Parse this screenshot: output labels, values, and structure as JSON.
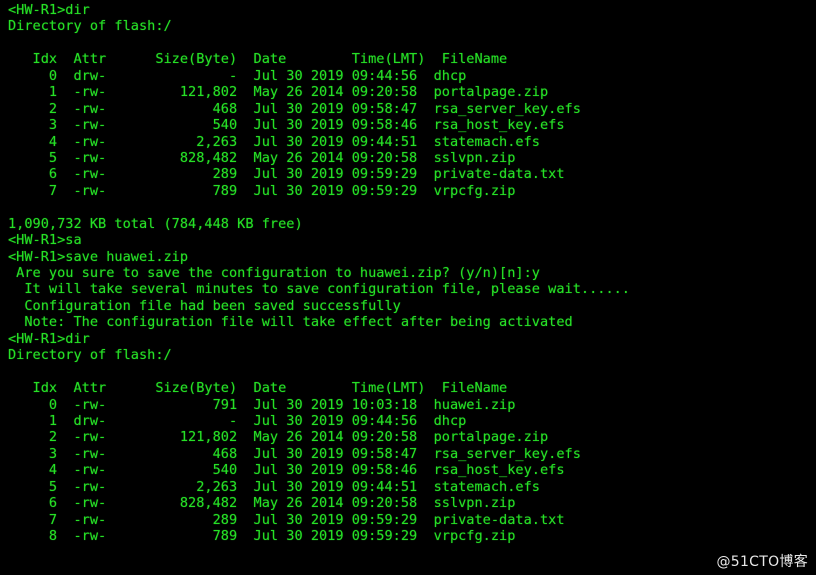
{
  "terminal": {
    "prompt": "<HW-R1>",
    "device_name": "HW-R1",
    "colors": {
      "background": "#000000",
      "text": "#26e026",
      "watermark": "#e8e8e8"
    },
    "watermark": "@51CTO博客",
    "columns": {
      "idx": "Idx",
      "attr": "Attr",
      "size": "Size(Byte)",
      "date": "Date",
      "time": "Time(LMT)",
      "filename": "FileName"
    },
    "lines": [
      {
        "id": "l01",
        "kind": "command",
        "text": "<HW-R1>dir"
      },
      {
        "id": "l02",
        "kind": "output",
        "text": "Directory of flash:/"
      },
      {
        "id": "l03",
        "kind": "blank",
        "text": ""
      },
      {
        "id": "l04",
        "kind": "header",
        "text": "   Idx  Attr      Size(Byte)  Date        Time(LMT)  FileName"
      },
      {
        "id": "l05",
        "kind": "row",
        "text": "     0  drw-               -  Jul 30 2019 09:44:56  dhcp"
      },
      {
        "id": "l06",
        "kind": "row",
        "text": "     1  -rw-         121,802  May 26 2014 09:20:58  portalpage.zip"
      },
      {
        "id": "l07",
        "kind": "row",
        "text": "     2  -rw-             468  Jul 30 2019 09:58:47  rsa_server_key.efs"
      },
      {
        "id": "l08",
        "kind": "row",
        "text": "     3  -rw-             540  Jul 30 2019 09:58:46  rsa_host_key.efs"
      },
      {
        "id": "l09",
        "kind": "row",
        "text": "     4  -rw-           2,263  Jul 30 2019 09:44:51  statemach.efs"
      },
      {
        "id": "l10",
        "kind": "row",
        "text": "     5  -rw-         828,482  May 26 2014 09:20:58  sslvpn.zip"
      },
      {
        "id": "l11",
        "kind": "row",
        "text": "     6  -rw-             289  Jul 30 2019 09:59:29  private-data.txt"
      },
      {
        "id": "l12",
        "kind": "row",
        "text": "     7  -rw-             789  Jul 30 2019 09:59:29  vrpcfg.zip"
      },
      {
        "id": "l13",
        "kind": "blank",
        "text": ""
      },
      {
        "id": "l14",
        "kind": "output",
        "text": "1,090,732 KB total (784,448 KB free)"
      },
      {
        "id": "l15",
        "kind": "command",
        "text": "<HW-R1>sa"
      },
      {
        "id": "l16",
        "kind": "command",
        "text": "<HW-R1>save huawei.zip"
      },
      {
        "id": "l17",
        "kind": "output",
        "text": " Are you sure to save the configuration to huawei.zip? (y/n)[n]:y"
      },
      {
        "id": "l18",
        "kind": "output",
        "text": "  It will take several minutes to save configuration file, please wait......"
      },
      {
        "id": "l19",
        "kind": "output",
        "text": "  Configuration file had been saved successfully"
      },
      {
        "id": "l20",
        "kind": "output",
        "text": "  Note: The configuration file will take effect after being activated"
      },
      {
        "id": "l21",
        "kind": "command",
        "text": "<HW-R1>dir"
      },
      {
        "id": "l22",
        "kind": "output",
        "text": "Directory of flash:/"
      },
      {
        "id": "l23",
        "kind": "blank",
        "text": ""
      },
      {
        "id": "l24",
        "kind": "header",
        "text": "   Idx  Attr      Size(Byte)  Date        Time(LMT)  FileName"
      },
      {
        "id": "l25",
        "kind": "row",
        "text": "     0  -rw-             791  Jul 30 2019 10:03:18  huawei.zip"
      },
      {
        "id": "l26",
        "kind": "row",
        "text": "     1  drw-               -  Jul 30 2019 09:44:56  dhcp"
      },
      {
        "id": "l27",
        "kind": "row",
        "text": "     2  -rw-         121,802  May 26 2014 09:20:58  portalpage.zip"
      },
      {
        "id": "l28",
        "kind": "row",
        "text": "     3  -rw-             468  Jul 30 2019 09:58:47  rsa_server_key.efs"
      },
      {
        "id": "l29",
        "kind": "row",
        "text": "     4  -rw-             540  Jul 30 2019 09:58:46  rsa_host_key.efs"
      },
      {
        "id": "l30",
        "kind": "row",
        "text": "     5  -rw-           2,263  Jul 30 2019 09:44:51  statemach.efs"
      },
      {
        "id": "l31",
        "kind": "row",
        "text": "     6  -rw-         828,482  May 26 2014 09:20:58  sslvpn.zip"
      },
      {
        "id": "l32",
        "kind": "row",
        "text": "     7  -rw-             289  Jul 30 2019 09:59:29  private-data.txt"
      },
      {
        "id": "l33",
        "kind": "row",
        "text": "     8  -rw-             789  Jul 30 2019 09:59:29  vrpcfg.zip"
      }
    ],
    "listing_one": {
      "path": "flash:/",
      "total_text": "1,090,732 KB total (784,448 KB free)",
      "total_kb": "1,090,732",
      "free_kb": "784,448",
      "entries": [
        {
          "idx": "0",
          "attr": "drw-",
          "size": "-",
          "date": "Jul 30 2019",
          "time": "09:44:56",
          "filename": "dhcp"
        },
        {
          "idx": "1",
          "attr": "-rw-",
          "size": "121,802",
          "date": "May 26 2014",
          "time": "09:20:58",
          "filename": "portalpage.zip"
        },
        {
          "idx": "2",
          "attr": "-rw-",
          "size": "468",
          "date": "Jul 30 2019",
          "time": "09:58:47",
          "filename": "rsa_server_key.efs"
        },
        {
          "idx": "3",
          "attr": "-rw-",
          "size": "540",
          "date": "Jul 30 2019",
          "time": "09:58:46",
          "filename": "rsa_host_key.efs"
        },
        {
          "idx": "4",
          "attr": "-rw-",
          "size": "2,263",
          "date": "Jul 30 2019",
          "time": "09:44:51",
          "filename": "statemach.efs"
        },
        {
          "idx": "5",
          "attr": "-rw-",
          "size": "828,482",
          "date": "May 26 2014",
          "time": "09:20:58",
          "filename": "sslvpn.zip"
        },
        {
          "idx": "6",
          "attr": "-rw-",
          "size": "289",
          "date": "Jul 30 2019",
          "time": "09:59:29",
          "filename": "private-data.txt"
        },
        {
          "idx": "7",
          "attr": "-rw-",
          "size": "789",
          "date": "Jul 30 2019",
          "time": "09:59:29",
          "filename": "vrpcfg.zip"
        }
      ]
    },
    "save_session": {
      "typed_partial": "sa",
      "command": "save huawei.zip",
      "confirm_prompt": "Are you sure to save the configuration to huawei.zip? (y/n)[n]:",
      "confirm_answer": "y",
      "progress": "It will take several minutes to save configuration file, please wait......",
      "result": "Configuration file had been saved successfully",
      "note": "Note: The configuration file will take effect after being activated"
    },
    "listing_two": {
      "path": "flash:/",
      "entries": [
        {
          "idx": "0",
          "attr": "-rw-",
          "size": "791",
          "date": "Jul 30 2019",
          "time": "10:03:18",
          "filename": "huawei.zip"
        },
        {
          "idx": "1",
          "attr": "drw-",
          "size": "-",
          "date": "Jul 30 2019",
          "time": "09:44:56",
          "filename": "dhcp"
        },
        {
          "idx": "2",
          "attr": "-rw-",
          "size": "121,802",
          "date": "May 26 2014",
          "time": "09:20:58",
          "filename": "portalpage.zip"
        },
        {
          "idx": "3",
          "attr": "-rw-",
          "size": "468",
          "date": "Jul 30 2019",
          "time": "09:58:47",
          "filename": "rsa_server_key.efs"
        },
        {
          "idx": "4",
          "attr": "-rw-",
          "size": "540",
          "date": "Jul 30 2019",
          "time": "09:58:46",
          "filename": "rsa_host_key.efs"
        },
        {
          "idx": "5",
          "attr": "-rw-",
          "size": "2,263",
          "date": "Jul 30 2019",
          "time": "09:44:51",
          "filename": "statemach.efs"
        },
        {
          "idx": "6",
          "attr": "-rw-",
          "size": "828,482",
          "date": "May 26 2014",
          "time": "09:20:58",
          "filename": "sslvpn.zip"
        },
        {
          "idx": "7",
          "attr": "-rw-",
          "size": "289",
          "date": "Jul 30 2019",
          "time": "09:59:29",
          "filename": "private-data.txt"
        },
        {
          "idx": "8",
          "attr": "-rw-",
          "size": "789",
          "date": "Jul 30 2019",
          "time": "09:59:29",
          "filename": "vrpcfg.zip"
        }
      ]
    }
  }
}
